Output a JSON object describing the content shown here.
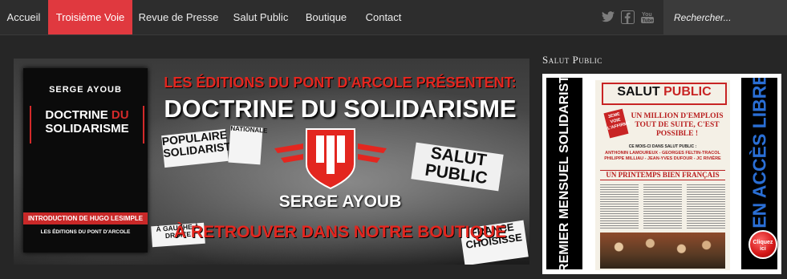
{
  "nav": {
    "items": [
      {
        "label": "Accueil"
      },
      {
        "label": "Troisième Voie",
        "active": true
      },
      {
        "label": "Revue de Presse"
      },
      {
        "label": "Salut Public"
      },
      {
        "label": "Boutique"
      },
      {
        "label": "Contact"
      }
    ],
    "active_color": "#e0393f",
    "social": [
      "twitter-icon",
      "facebook-icon",
      "youtube-icon"
    ],
    "search": {
      "placeholder": "Rechercher..."
    }
  },
  "banner": {
    "book": {
      "author": "SERGE AYOUB",
      "title_line1": "DOCTRINE",
      "title_red": "DU",
      "title_line2": "SOLIDARISME",
      "strip": "INTRODUCTION DE HUGO LESIMPLE",
      "publisher": "LES ÉDITIONS DU PONT D'ARCOLE"
    },
    "headline1": "LES ÉDITIONS DU PONT D'ARCOLE PRÉSENTENT:",
    "headline2": "DOCTRINE DU SOLIDARISME",
    "author": "SERGE AYOUB",
    "tagline": "À RETROUVER DANS NOTRE BOUTIQUE",
    "signs": {
      "populaire": "POPULAIRE SOLIDARISTE",
      "salut": "SALUT PUBLIC",
      "nationale": "NATIONALE",
      "gauche": "À GAUCHE À DROITE",
      "france": "FRANCE CHOISISSE"
    },
    "accent": "#e3261f"
  },
  "sidebar": {
    "title": "Salut Public",
    "promo": {
      "left_vertical": "PREMIER MENSUEL SOLIDARISTE",
      "right_vertical": "EN ACCÈS LIBRE",
      "right_color": "#2a6fd6",
      "newspaper": {
        "mast": "SALUT",
        "mast_red": "PUBLIC",
        "tag": "3EME VOIE L'AFFIRME",
        "headline": "UN MILLION D'EMPLOIS TOUT DE SUITE, C'EST POSSIBLE !",
        "subhead": "CE MOIS-CI DANS SALUT PUBLIC :",
        "authors": "ANTHONIN LAMOUREUX - GEORGES FELTIN-TRACOL PHILIPPE MILLIAU - JEAN-YVES DUFOUR - JC RIVIÈRE",
        "section": "UN PRINTEMPS BIEN FRANÇAIS"
      },
      "cta": "Cliquez ici"
    }
  }
}
